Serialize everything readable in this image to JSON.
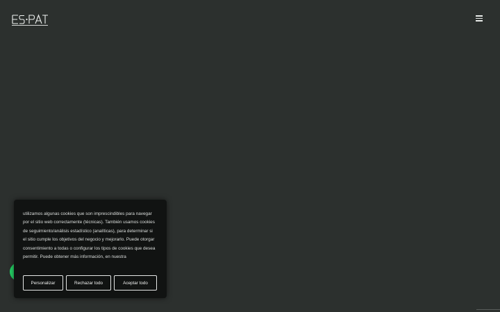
{
  "header": {
    "logo_text": "ES·PAT",
    "menu_icon": "hamburger-menu-icon"
  },
  "chat_widget": {
    "icon": "whatsapp-icon",
    "color": "#25d366"
  },
  "cookie_banner": {
    "text": "utilizamos algunas cookies que son imprescindibles para navegar por el sitio web correctamente (técnicas). También usamos cookies de seguimiento/análisis estadístico (analíticas), para determinar si el sitio cumple los objetivos del negocio y mejorarlo. Puede otorgar consentimiento a todas o configurar los tipos de cookies que desea permitir. Puede obtener más información, en nuestra",
    "customize_label": "Personalizar",
    "reject_label": "Rechazar todo",
    "accept_label": "Aceptar todo"
  },
  "colors": {
    "background": "#2c302e",
    "banner_background": "#111312",
    "text": "#dcdfdd"
  }
}
